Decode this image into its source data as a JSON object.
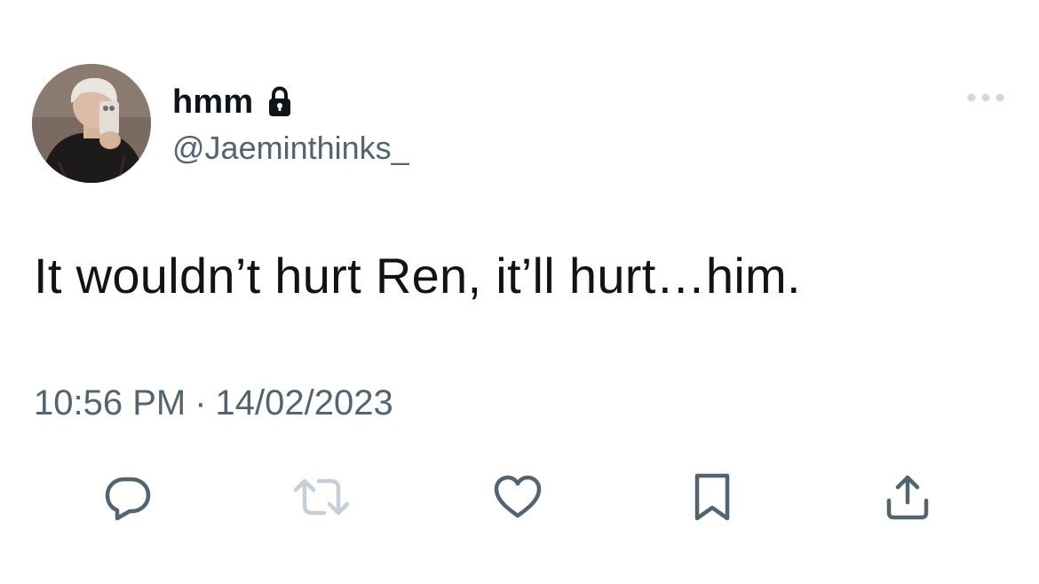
{
  "tweet": {
    "display_name": "hmm",
    "handle": "@Jaeminthinks_",
    "protected": true,
    "text": "It wouldn’t hurt Ren, it’ll hurt…him.",
    "time": "10:56 PM",
    "separator": "·",
    "date": "14/02/2023"
  },
  "icons": {
    "lock": "lock-icon",
    "more": "more-dots-icon",
    "reply": "speech-bubble-icon",
    "retweet": "retweet-arrows-icon",
    "like": "heart-icon",
    "bookmark": "bookmark-icon",
    "share": "share-upload-icon"
  },
  "colors": {
    "text_primary": "#0f1419",
    "text_secondary": "#536471",
    "icon_gray": "#536471",
    "retweet_disabled": "#c4cfd6",
    "more_dots": "#cfd9de"
  }
}
